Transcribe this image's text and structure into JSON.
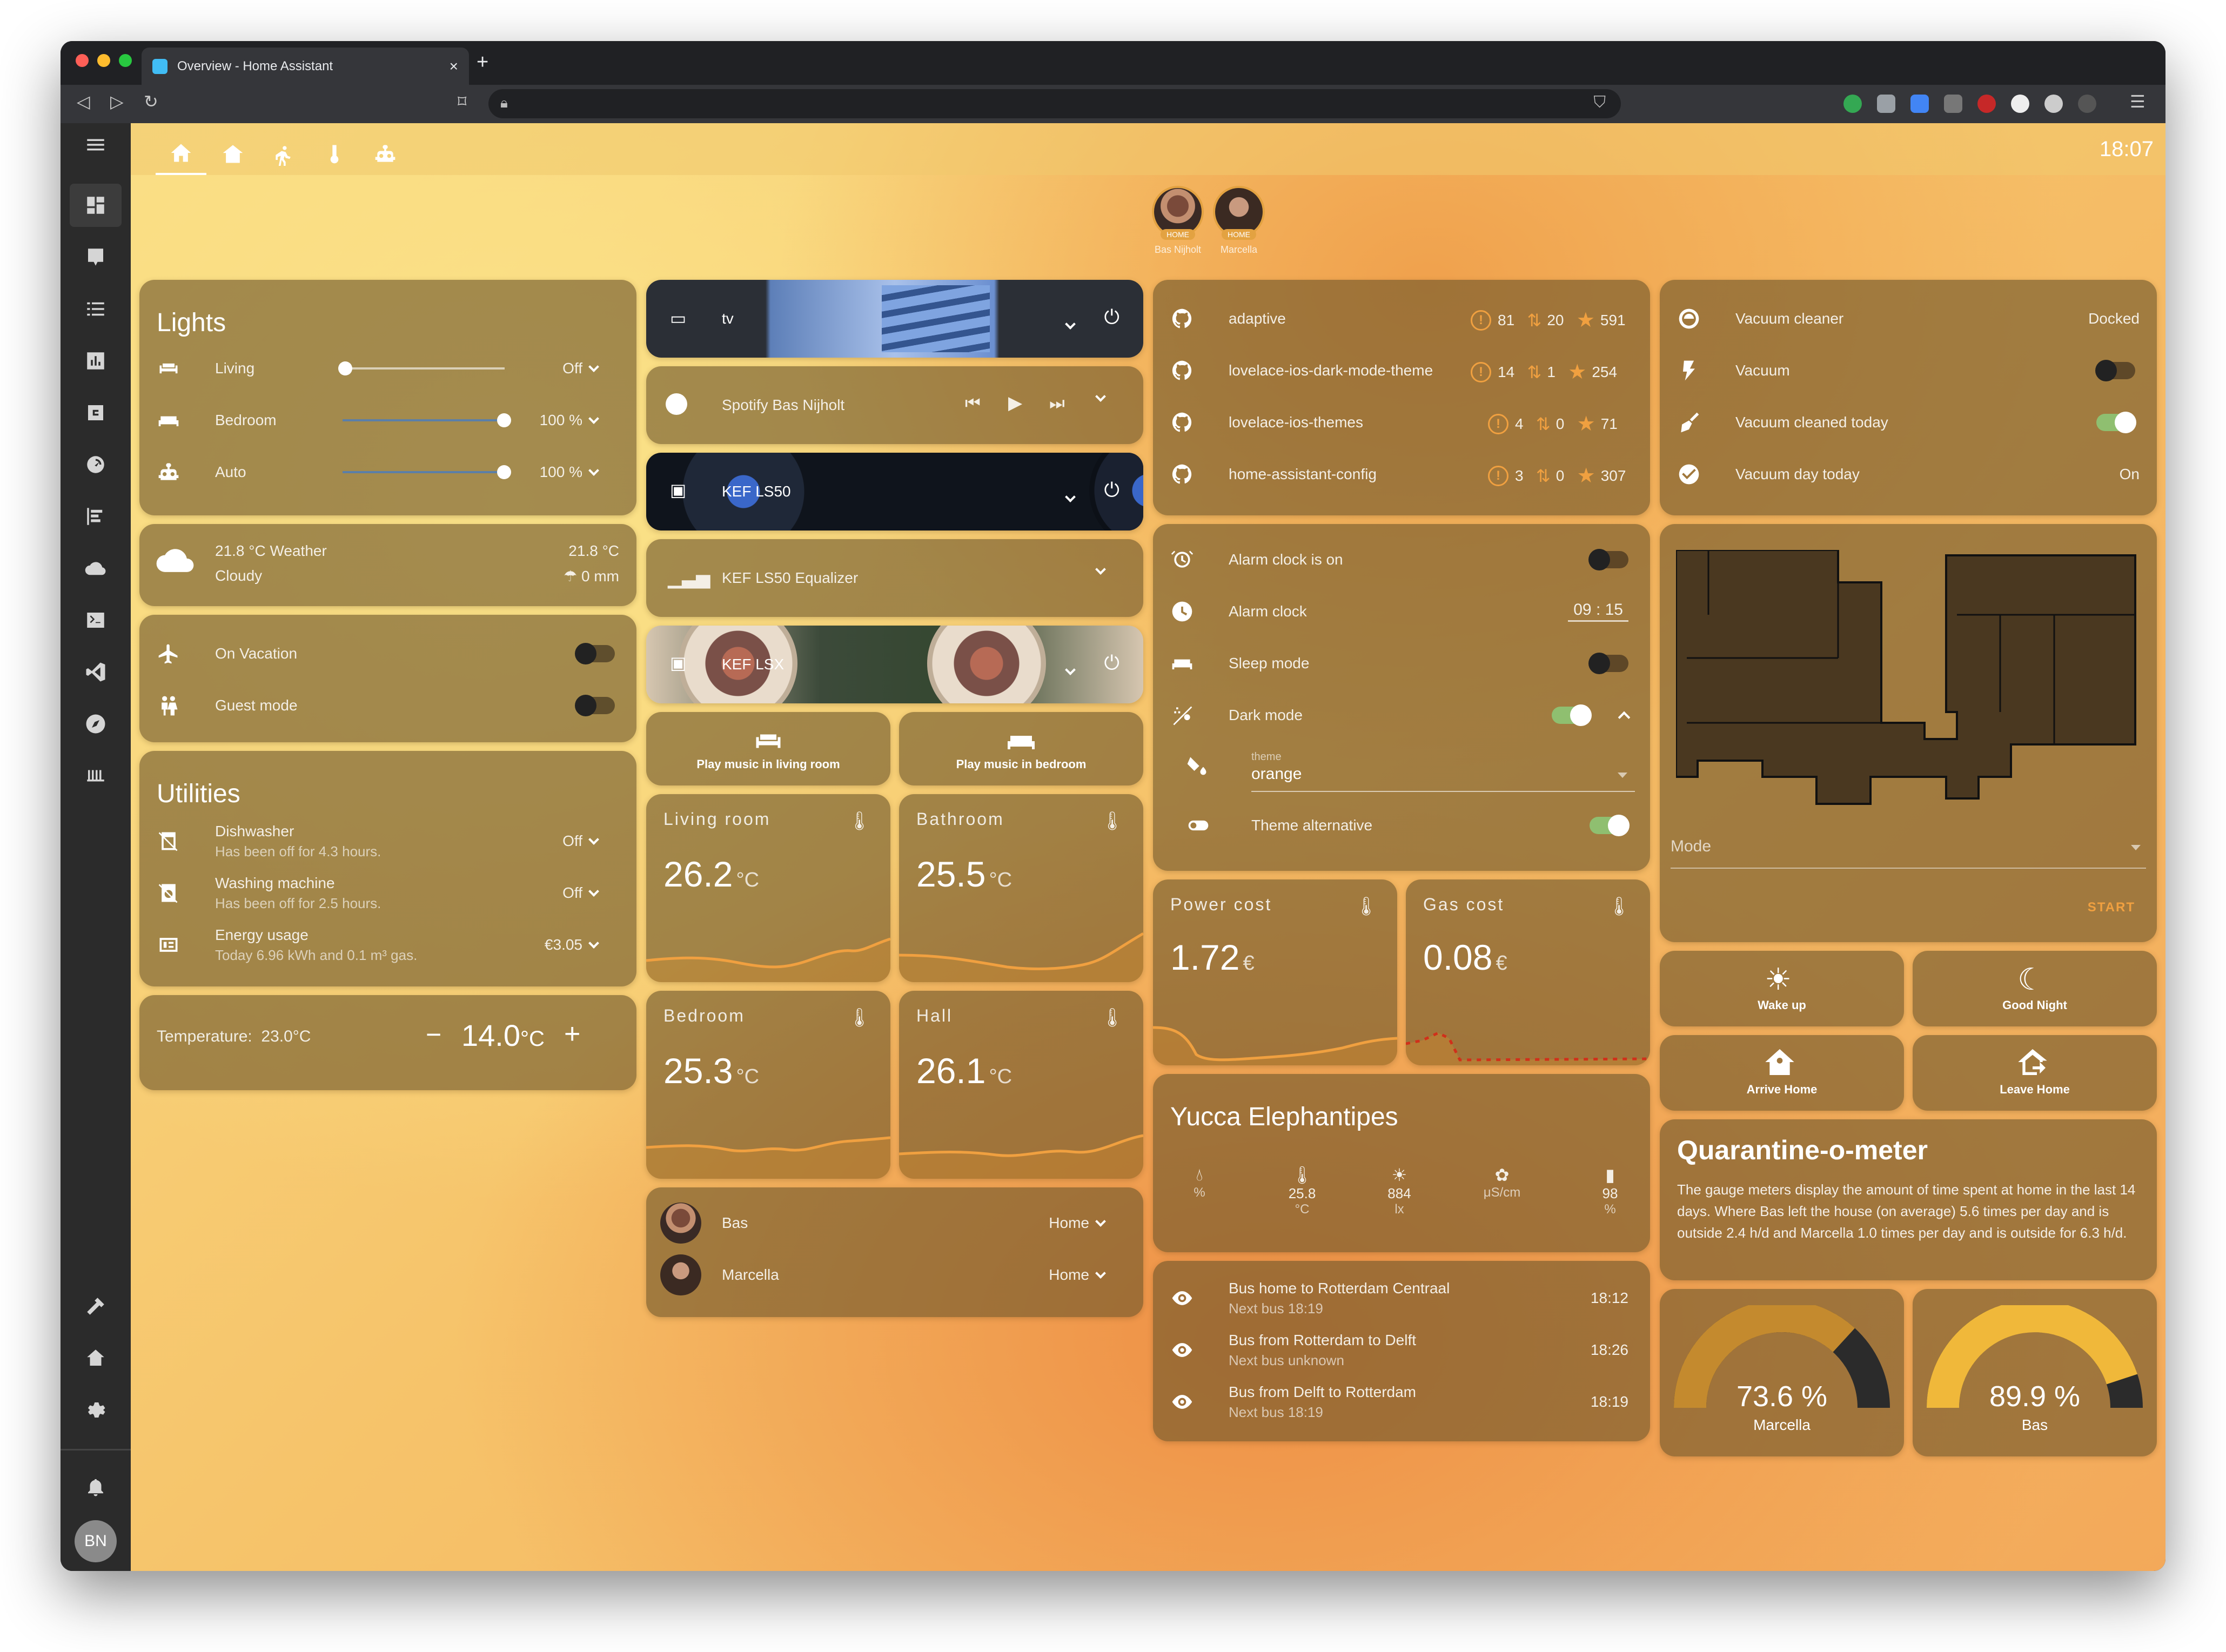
{
  "browser": {
    "tab_title": "Overview - Home Assistant",
    "new_tab": "+",
    "tab_close": "×"
  },
  "header": {
    "time": "18:07"
  },
  "persons_top": [
    {
      "badge": "HOME",
      "name": "Bas Nijholt"
    },
    {
      "badge": "HOME",
      "name": "Marcella"
    }
  ],
  "lights": {
    "title": "Lights",
    "items": [
      {
        "name": "Living",
        "state": "Off",
        "level": 0
      },
      {
        "name": "Bedroom",
        "state": "100 %",
        "level": 100
      },
      {
        "name": "Auto",
        "state": "100 %",
        "level": 100
      }
    ]
  },
  "weather": {
    "line1": "21.8 °C Weather",
    "line2": "Cloudy",
    "temp": "21.8 °C",
    "rain": "0 mm"
  },
  "modes": [
    {
      "name": "On Vacation",
      "on": false
    },
    {
      "name": "Guest mode",
      "on": false
    }
  ],
  "utilities": {
    "title": "Utilities",
    "items": [
      {
        "name": "Dishwasher",
        "sub": "Has been off for 4.3 hours.",
        "state": "Off"
      },
      {
        "name": "Washing machine",
        "sub": "Has been off for 2.5 hours.",
        "state": "Off"
      },
      {
        "name": "Energy usage",
        "sub": "Today 6.96 kWh and 0.1 m³ gas.",
        "state": "€3.05"
      }
    ]
  },
  "thermostat": {
    "label": "Temperature:",
    "current": "23.0°C",
    "minus": "−",
    "target": "14.0",
    "unit": "°C",
    "plus": "+"
  },
  "media": {
    "tv": "tv",
    "spotify": "Spotify Bas Nijholt",
    "kef_ls50": "KEF LS50",
    "equalizer": "KEF LS50 Equalizer",
    "kef_lsx": "KEF LSX",
    "play_living": "Play music in living room",
    "play_bedroom": "Play music in bedroom"
  },
  "temps": [
    {
      "name": "Living room",
      "value": "26.2",
      "unit": "°C"
    },
    {
      "name": "Bathroom",
      "value": "25.5",
      "unit": "°C"
    },
    {
      "name": "Bedroom",
      "value": "25.3",
      "unit": "°C"
    },
    {
      "name": "Hall",
      "value": "26.1",
      "unit": "°C"
    }
  ],
  "people": [
    {
      "name": "Bas",
      "state": "Home"
    },
    {
      "name": "Marcella",
      "state": "Home"
    }
  ],
  "repos": [
    {
      "name": "adaptive",
      "issues": "81",
      "prs": "20",
      "stars": "591"
    },
    {
      "name": "lovelace-ios-dark-mode-theme",
      "issues": "14",
      "prs": "1",
      "stars": "254"
    },
    {
      "name": "lovelace-ios-themes",
      "issues": "4",
      "prs": "0",
      "stars": "71"
    },
    {
      "name": "home-assistant-config",
      "issues": "3",
      "prs": "0",
      "stars": "307"
    }
  ],
  "alarm": {
    "items": [
      {
        "name": "Alarm clock is on"
      },
      {
        "name": "Alarm clock",
        "value": "09 : 15"
      },
      {
        "name": "Sleep mode"
      },
      {
        "name": "Dark mode"
      }
    ],
    "theme_label": "theme",
    "theme_value": "orange",
    "theme_alt": "Theme alternative"
  },
  "costs": [
    {
      "name": "Power cost",
      "value": "1.72",
      "unit": "€"
    },
    {
      "name": "Gas cost",
      "value": "0.08",
      "unit": "€"
    }
  ],
  "plant": {
    "title": "Yucca Elephantipes",
    "sensors": [
      {
        "value": "",
        "unit": "%"
      },
      {
        "value": "25.8",
        "unit": "°C"
      },
      {
        "value": "884",
        "unit": "lx"
      },
      {
        "value": "",
        "unit": "μS/cm"
      },
      {
        "value": "98",
        "unit": "%"
      }
    ]
  },
  "buses": [
    {
      "name": "Bus home to Rotterdam Centraal",
      "sub": "Next bus 18:19",
      "time": "18:12"
    },
    {
      "name": "Bus from Rotterdam to Delft",
      "sub": "Next bus unknown",
      "time": "18:26"
    },
    {
      "name": "Bus from Delft to Rotterdam",
      "sub": "Next bus 18:19",
      "time": "18:19"
    }
  ],
  "vacuum": {
    "items": [
      {
        "name": "Vacuum cleaner",
        "state": "Docked"
      },
      {
        "name": "Vacuum"
      },
      {
        "name": "Vacuum cleaned today"
      },
      {
        "name": "Vacuum day today",
        "state": "On"
      }
    ],
    "mode_label": "Mode",
    "start": "START"
  },
  "scenes": [
    {
      "name": "Wake up"
    },
    {
      "name": "Good Night"
    },
    {
      "name": "Arrive Home"
    },
    {
      "name": "Leave Home"
    }
  ],
  "quarantine": {
    "title": "Quarantine-o-meter",
    "text": "The gauge meters display the amount of time spent at home in the last 14 days. Where Bas left the house (on average) 5.6 times per day and is outside 2.4 h/d and Marcella 1.0 times per day and is outside for 6.3 h/d."
  },
  "gauges": [
    {
      "value": "73.6 %",
      "name": "Marcella",
      "fraction": 0.736,
      "color": "#c48a2e"
    },
    {
      "value": "89.9 %",
      "name": "Bas",
      "fraction": 0.899,
      "color": "#f0b83a"
    }
  ],
  "user_initials": "BN"
}
